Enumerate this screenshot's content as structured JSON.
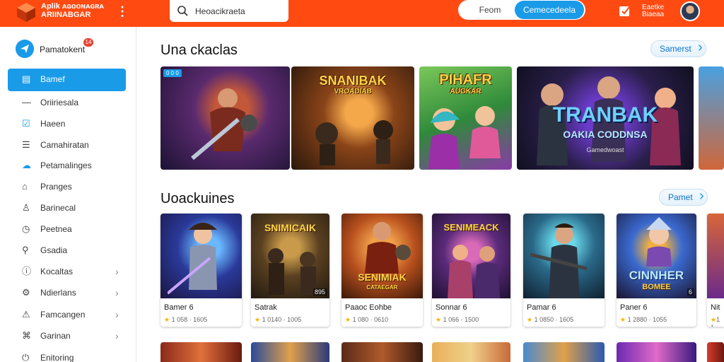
{
  "header": {
    "logo_line1": "Aplik ᴀɢᴏᴏɴᴀɢʀᴀ",
    "logo_line2": "ARIINABGAR",
    "search_text": "Heoacikraeta",
    "seg_left": "Feom",
    "seg_right": "Cemecedeela",
    "user_line1": "Eaetke",
    "user_line2": "Biaeaa"
  },
  "sidebar": {
    "head_label": "Pamatokent",
    "head_badge": "14",
    "items": [
      {
        "label": "Bamef",
        "icon": "document-icon",
        "active": true,
        "chevron": false
      },
      {
        "label": "Oriiriesala",
        "icon": "line-icon",
        "active": false,
        "chevron": false
      },
      {
        "label": "Haeen",
        "icon": "checkbox-icon",
        "active": false,
        "chevron": false
      },
      {
        "label": "Camahiratan",
        "icon": "list-icon",
        "active": false,
        "chevron": false
      },
      {
        "label": "Petamalinges",
        "icon": "cloud-icon",
        "active": false,
        "chevron": false
      },
      {
        "label": "Pranges",
        "icon": "tag-icon",
        "active": false,
        "chevron": false
      },
      {
        "label": "Barinecal",
        "icon": "user-icon",
        "active": false,
        "chevron": false
      },
      {
        "label": "Peetnea",
        "icon": "clock-icon",
        "active": false,
        "chevron": false
      },
      {
        "label": "Gsadia",
        "icon": "search-icon",
        "active": false,
        "chevron": false
      },
      {
        "label": "Kocaltas",
        "icon": "info-icon",
        "active": false,
        "chevron": true
      },
      {
        "label": "Ndierlans",
        "icon": "settings-icon",
        "active": false,
        "chevron": true
      },
      {
        "label": "Famcangen",
        "icon": "alert-icon",
        "active": false,
        "chevron": true
      },
      {
        "label": "Garinan",
        "icon": "gamepad-icon",
        "active": false,
        "chevron": true
      },
      {
        "label": "Enitoring",
        "icon": "power-icon",
        "active": false,
        "chevron": false
      }
    ]
  },
  "section1": {
    "title": "Una ckaclas",
    "button": "Samerst",
    "chip": "0 0 0",
    "banners": [
      {
        "text": "",
        "sub": ""
      },
      {
        "text": "SNANIBAK",
        "sub": "VROADIAB"
      },
      {
        "text": "PIHAFR",
        "sub": "AUGKAR"
      },
      {
        "text": "TRANBAK",
        "sub": "OAKIA CODDNSA"
      },
      {
        "text": "",
        "sub": ""
      }
    ],
    "banner4_caption": "Gamedwoast"
  },
  "section2": {
    "title": "Uoackuines",
    "button": "Pamet",
    "cards": [
      {
        "title": "Bamer 6",
        "meta": "1 058 · 1605",
        "thumb_text": "",
        "thumb_sub": "",
        "tag": ""
      },
      {
        "title": "Satrak",
        "meta": "1 0140 · 1005",
        "thumb_text": "SNIMICAIK",
        "thumb_sub": "",
        "tag": "895"
      },
      {
        "title": "Paaoc Eohbe",
        "meta": "1 080 · 0610",
        "thumb_text": "SENIMIAK",
        "thumb_sub": "CATAEGAR",
        "tag": ""
      },
      {
        "title": "Sonnar 6",
        "meta": "1 066 · 1500",
        "thumb_text": "SENIMEACK",
        "thumb_sub": "",
        "tag": ""
      },
      {
        "title": "Pamar 6",
        "meta": "1 0850 · 1605",
        "thumb_text": "",
        "thumb_sub": "",
        "tag": ""
      },
      {
        "title": "Paner 6",
        "meta": "1 2880 · 1055",
        "thumb_text": "CINNHER",
        "thumb_sub": "BOMEE",
        "tag": "6"
      },
      {
        "title": "Nit",
        "meta": "1 1",
        "thumb_text": "",
        "thumb_sub": "",
        "tag": ""
      }
    ]
  },
  "colors": {
    "accent_orange": "#ff4a12",
    "accent_blue": "#1a9be8"
  }
}
